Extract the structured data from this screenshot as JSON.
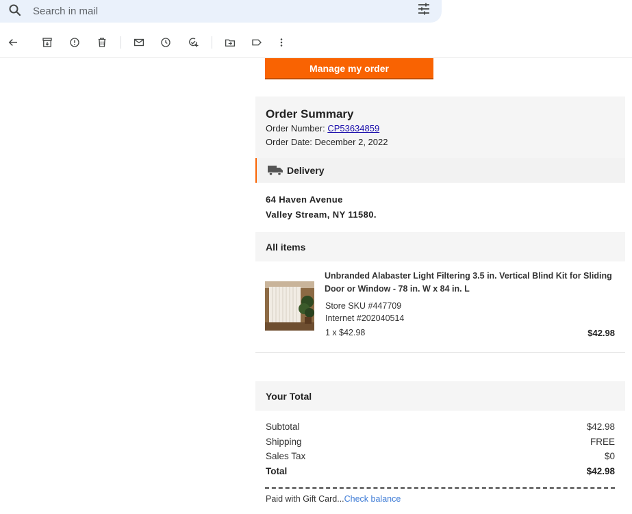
{
  "search": {
    "placeholder": "Search in mail"
  },
  "toolbar": {
    "buttons": [
      {
        "name": "back-button",
        "icon": "arrow-left-icon"
      },
      {
        "name": "archive-button",
        "icon": "archive-icon"
      },
      {
        "name": "report-spam-button",
        "icon": "report-icon"
      },
      {
        "name": "delete-button",
        "icon": "trash-icon"
      },
      {
        "name": "mark-unread-button",
        "icon": "mail-icon"
      },
      {
        "name": "snooze-button",
        "icon": "clock-icon"
      },
      {
        "name": "add-task-button",
        "icon": "add-task-icon"
      },
      {
        "name": "move-to-button",
        "icon": "folder-move-icon"
      },
      {
        "name": "labels-button",
        "icon": "label-icon"
      },
      {
        "name": "more-button",
        "icon": "more-vertical-icon"
      }
    ]
  },
  "email": {
    "manage_button": "Manage my order",
    "summary": {
      "title": "Order Summary",
      "order_number_label": "Order Number: ",
      "order_number": "CP53634859",
      "order_date": "Order Date: December 2, 2022"
    },
    "delivery": {
      "label": "Delivery",
      "address_line1": "64 Haven Avenue",
      "address_line2": "Valley Stream, NY 11580."
    },
    "items": {
      "heading": "All items",
      "product": {
        "name": "Unbranded Alabaster Light Filtering 3.5 in. Vertical Blind Kit for Sliding Door or Window - 78 in. W x 84 in. L",
        "sku": "Store SKU #447709",
        "internet": "Internet #202040514",
        "qty": "1 x $42.98",
        "price": "$42.98"
      }
    },
    "totals": {
      "heading": "Your Total",
      "subtotal_label": "Subtotal",
      "subtotal": "$42.98",
      "shipping_label": "Shipping",
      "shipping": "FREE",
      "tax_label": "Sales Tax",
      "tax": "$0",
      "total_label": "Total",
      "total": "$42.98"
    },
    "payment": {
      "paid_text": "Paid with Gift Card...",
      "check_balance": "Check balance"
    }
  },
  "colors": {
    "accent": "#f96302",
    "search_bg": "#eaf1fb",
    "link": "#1a0dab",
    "link_light": "#3d7bd6"
  }
}
